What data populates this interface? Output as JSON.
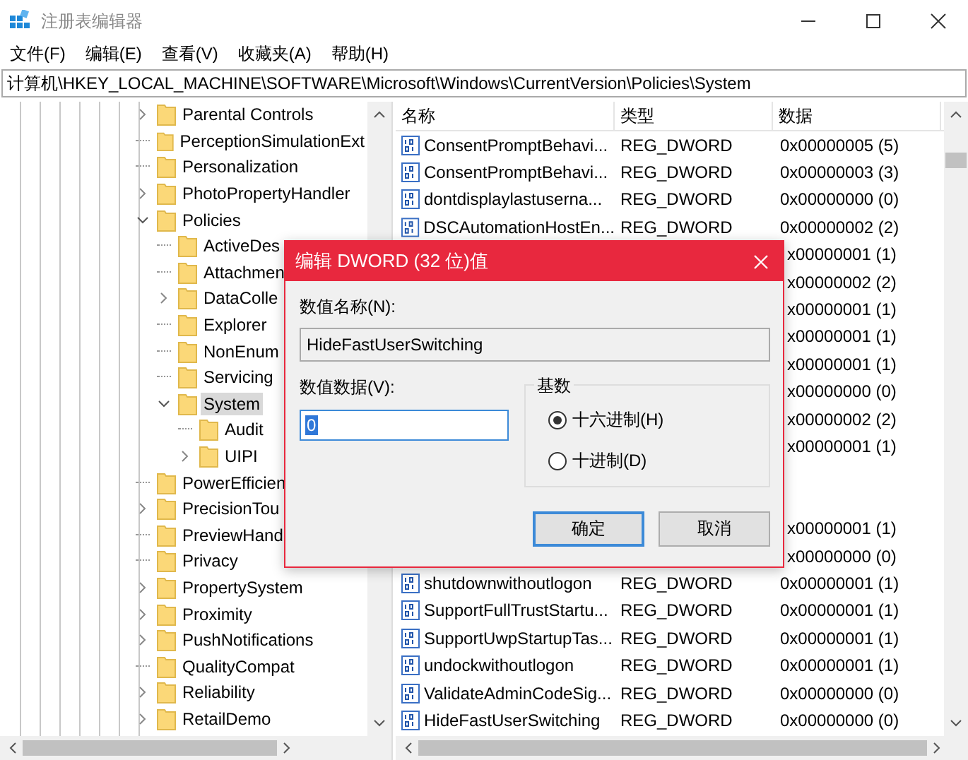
{
  "window": {
    "title": "注册表编辑器"
  },
  "menu": [
    "文件(F)",
    "编辑(E)",
    "查看(V)",
    "收藏夹(A)",
    "帮助(H)"
  ],
  "address": "计算机\\HKEY_LOCAL_MACHINE\\SOFTWARE\\Microsoft\\Windows\\CurrentVersion\\Policies\\System",
  "tree": [
    {
      "label": "Parental Controls",
      "expanded": false
    },
    {
      "label": "PerceptionSimulationExt"
    },
    {
      "label": "Personalization"
    },
    {
      "label": "PhotoPropertyHandler",
      "expanded": false
    },
    {
      "label": "Policies",
      "expanded": true,
      "children": [
        {
          "label": "ActiveDes"
        },
        {
          "label": "Attachmen"
        },
        {
          "label": "DataColle",
          "expanded": false
        },
        {
          "label": "Explorer"
        },
        {
          "label": "NonEnum"
        },
        {
          "label": "Servicing"
        },
        {
          "label": "System",
          "expanded": true,
          "selected": true,
          "children": [
            {
              "label": "Audit"
            },
            {
              "label": "UIPI",
              "expanded": false
            }
          ]
        }
      ]
    },
    {
      "label": "PowerEfficien"
    },
    {
      "label": "PrecisionTou",
      "expanded": false
    },
    {
      "label": "PreviewHand"
    },
    {
      "label": "Privacy"
    },
    {
      "label": "PropertySystem",
      "expanded": false
    },
    {
      "label": "Proximity",
      "expanded": false
    },
    {
      "label": "PushNotifications",
      "expanded": false
    },
    {
      "label": "QualityCompat"
    },
    {
      "label": "Reliability",
      "expanded": false
    },
    {
      "label": "RetailDemo",
      "expanded": false
    }
  ],
  "table": {
    "columns": [
      "名称",
      "类型",
      "数据"
    ],
    "rows": [
      {
        "kind": "full",
        "name": "ConsentPromptBehavi...",
        "type": "REG_DWORD",
        "data": "0x00000005 (5)"
      },
      {
        "kind": "full",
        "name": "ConsentPromptBehavi...",
        "type": "REG_DWORD",
        "data": "0x00000003 (3)"
      },
      {
        "kind": "full",
        "name": "dontdisplaylastuserna...",
        "type": "REG_DWORD",
        "data": "0x00000000 (0)"
      },
      {
        "kind": "full",
        "name": "DSCAutomationHostEn...",
        "type": "REG_DWORD",
        "data": "0x00000002 (2)"
      },
      {
        "kind": "covered",
        "data": "x00000001 (1)"
      },
      {
        "kind": "covered",
        "data": "x00000002 (2)"
      },
      {
        "kind": "covered",
        "data": "x00000001 (1)"
      },
      {
        "kind": "covered",
        "data": "x00000001 (1)"
      },
      {
        "kind": "covered",
        "data": "x00000001 (1)"
      },
      {
        "kind": "covered",
        "data": "x00000000 (0)"
      },
      {
        "kind": "covered",
        "data": "x00000002 (2)"
      },
      {
        "kind": "covered",
        "data": "x00000001 (1)"
      },
      {
        "kind": "covered"
      },
      {
        "kind": "covered"
      },
      {
        "kind": "covered",
        "data": "x00000001 (1)"
      },
      {
        "kind": "covered",
        "data": "x00000000 (0)"
      },
      {
        "kind": "full",
        "name": "shutdownwithoutlogon",
        "type": "REG_DWORD",
        "data": "0x00000001 (1)"
      },
      {
        "kind": "full",
        "name": "SupportFullTrustStartu...",
        "type": "REG_DWORD",
        "data": "0x00000001 (1)"
      },
      {
        "kind": "full",
        "name": "SupportUwpStartupTas...",
        "type": "REG_DWORD",
        "data": "0x00000001 (1)"
      },
      {
        "kind": "full",
        "name": "undockwithoutlogon",
        "type": "REG_DWORD",
        "data": "0x00000001 (1)"
      },
      {
        "kind": "full",
        "name": "ValidateAdminCodeSig...",
        "type": "REG_DWORD",
        "data": "0x00000000 (0)"
      },
      {
        "kind": "full",
        "name": "HideFastUserSwitching",
        "type": "REG_DWORD",
        "data": "0x00000000 (0)"
      }
    ]
  },
  "dialog": {
    "title": "编辑 DWORD (32 位)值",
    "name_label": "数值名称(N):",
    "name_value": "HideFastUserSwitching",
    "data_label": "数值数据(V):",
    "data_value": "0",
    "base_label": "基数",
    "radios": [
      {
        "label": "十六进制(H)",
        "selected": true
      },
      {
        "label": "十进制(D)",
        "selected": false
      }
    ],
    "buttons": [
      {
        "label": "确定",
        "default": true
      },
      {
        "label": "取消",
        "default": false
      }
    ]
  }
}
